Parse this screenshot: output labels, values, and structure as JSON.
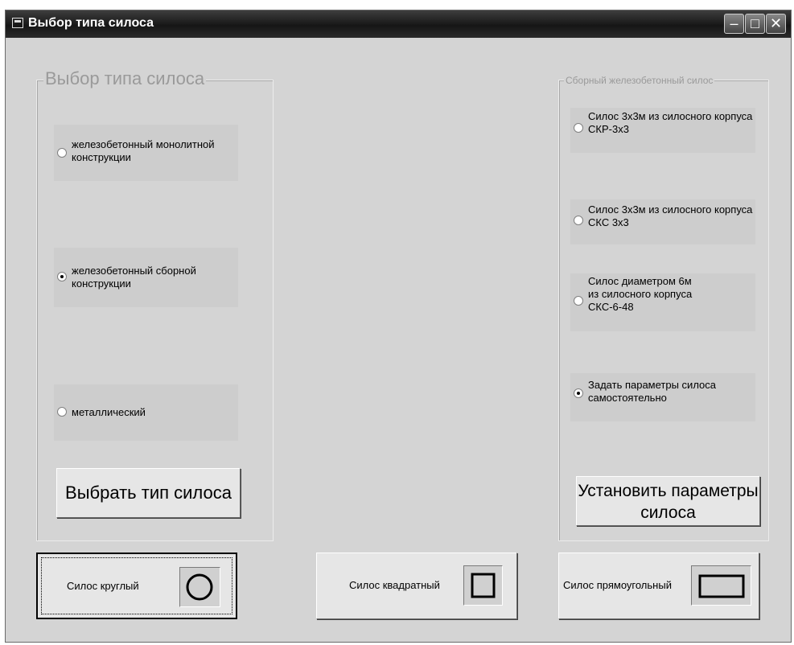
{
  "window": {
    "title": "Выбор типа силоса",
    "buttons": [
      "minimize-button",
      "maximize-button",
      "close-button"
    ]
  },
  "left_group": {
    "legend": "Выбор типа силоса",
    "options": [
      {
        "label": "железобетонный монолитной конструкции",
        "checked": false
      },
      {
        "label": "железобетонный сборной конструкции",
        "checked": true
      },
      {
        "label": "металлический",
        "checked": false
      }
    ],
    "button_label": "Выбрать тип силоса"
  },
  "right_group": {
    "legend": "Сборный железобетонный силос",
    "options": [
      {
        "label": "Силос 3х3м из силосного корпуса СКР-3х3",
        "checked": false
      },
      {
        "label": "Силос 3х3м из силосного корпуса СКС 3х3",
        "checked": false
      },
      {
        "label": "Силос диаметром 6м из силосного корпуса СКС-6-48",
        "checked": false
      },
      {
        "label": "Задать параметры силоса самостоятельно",
        "checked": true
      }
    ],
    "button_label": "Установить параметры силоса"
  },
  "shape_buttons": {
    "round": {
      "label": "Силос круглый",
      "icon": "circle-icon"
    },
    "square": {
      "label": "Силос квадратный",
      "icon": "square-icon"
    },
    "rect": {
      "label": "Силос прямоугольный",
      "icon": "rectangle-icon"
    }
  }
}
